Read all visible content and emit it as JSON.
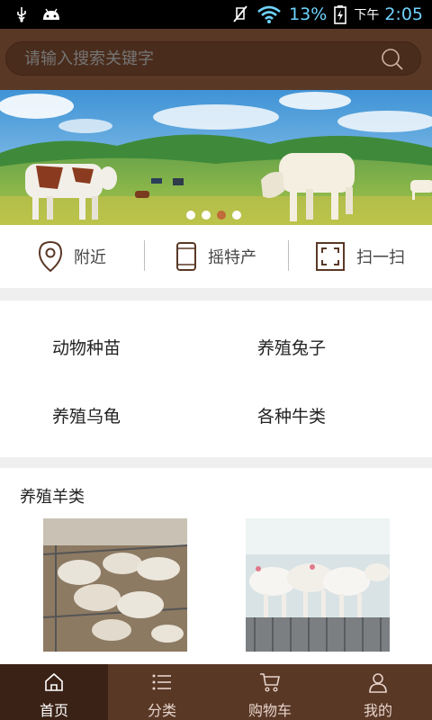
{
  "status_bar": {
    "battery_percent": "13%",
    "time_prefix": "下午",
    "time": "2:05",
    "icons": [
      "usb-icon",
      "android-icon",
      "mute-icon",
      "wifi-icon",
      "battery-icon"
    ]
  },
  "search": {
    "placeholder": "请输入搜索关键字",
    "icon": "search-icon"
  },
  "banner": {
    "slide_count": 4,
    "active_slide_index": 2
  },
  "quick_actions": [
    {
      "label": "附近",
      "icon": "location-pin-icon"
    },
    {
      "label": "摇特产",
      "icon": "phone-icon"
    },
    {
      "label": "扫一扫",
      "icon": "scan-icon"
    }
  ],
  "categories": [
    "动物种苗",
    "养殖兔子",
    "养殖乌龟",
    "各种牛类"
  ],
  "section": {
    "title": "养殖羊类"
  },
  "bottom_nav": [
    {
      "label": "首页",
      "icon": "home-icon",
      "active": true
    },
    {
      "label": "分类",
      "icon": "list-icon",
      "active": false
    },
    {
      "label": "购物车",
      "icon": "cart-icon",
      "active": false
    },
    {
      "label": "我的",
      "icon": "user-icon",
      "active": false
    }
  ],
  "colors": {
    "header_brown": "#5a3826",
    "nav_active": "#3a2216",
    "accent_dot": "#c16a3a"
  }
}
